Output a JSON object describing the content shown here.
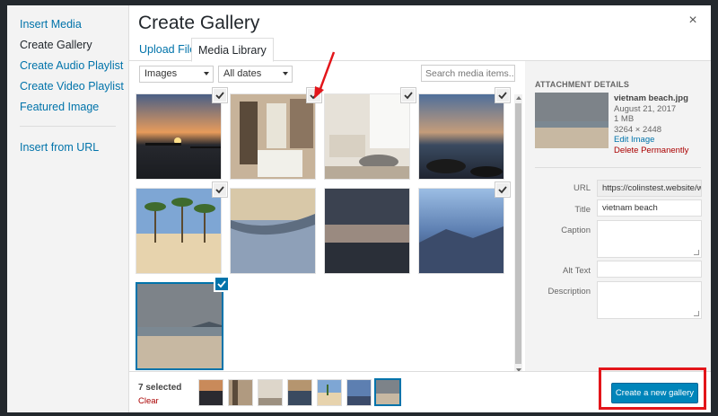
{
  "menu": {
    "items": [
      {
        "label": "Insert Media",
        "active": false
      },
      {
        "label": "Create Gallery",
        "active": true
      },
      {
        "label": "Create Audio Playlist",
        "active": false
      },
      {
        "label": "Create Video Playlist",
        "active": false
      },
      {
        "label": "Featured Image",
        "active": false
      }
    ],
    "url_item": "Insert from URL"
  },
  "modal": {
    "title": "Create Gallery",
    "close_icon": "close-icon"
  },
  "tabs": {
    "upload": "Upload Files",
    "library": "Media Library"
  },
  "filters": {
    "type": "Images",
    "date": "All dates",
    "search_placeholder": "Search media items..."
  },
  "attachment": {
    "heading": "ATTACHMENT DETAILS",
    "filename": "vietnam beach.jpg",
    "date": "August 21, 2017",
    "size": "1 MB",
    "dimensions": "3264 × 2448",
    "edit_link": "Edit Image",
    "delete_link": "Delete Permanently",
    "fields": {
      "url_label": "URL",
      "url_value": "https://colinstest.website/wp-",
      "title_label": "Title",
      "title_value": "vietnam beach",
      "caption_label": "Caption",
      "alt_label": "Alt Text",
      "description_label": "Description"
    }
  },
  "footer": {
    "selected_count": "7 selected",
    "clear_label": "Clear",
    "create_button": "Create a new gallery"
  },
  "colors": {
    "primary": "#0073aa",
    "button": "#0085ba",
    "delete": "#a00000",
    "highlight": "#e3151a"
  }
}
